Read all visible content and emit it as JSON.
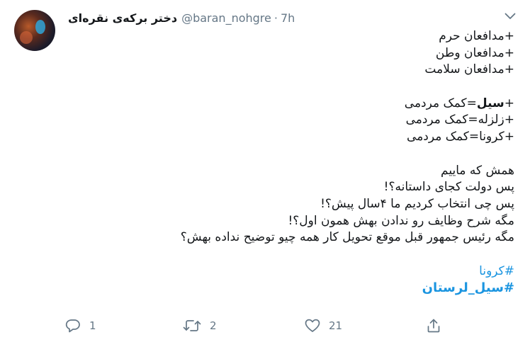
{
  "tweet": {
    "author": {
      "display_name": "دختر برکه‌ی نقره‌ای",
      "handle": "@baran_nohgre",
      "separator": "·",
      "time": "7h"
    },
    "lines": [
      "+مدافعان حرم",
      "+مدافعان وطن",
      "+مدافعان سلامت"
    ],
    "lines2": [
      {
        "prefix": "+",
        "bold": "سیل",
        "rest": "=کمک مردمی"
      },
      {
        "prefix": "",
        "bold": "",
        "rest": "+زلزله=کمک مردمی"
      },
      {
        "prefix": "",
        "bold": "",
        "rest": "+کرونا=کمک مردمی"
      }
    ],
    "lines3": [
      "همش که ماییم",
      "پس دولت کجای داستانه؟!",
      "پس چی انتخاب کردیم ما ۴سال پیش؟!",
      "مگه شرح وظایف رو ندادن بهش همون اول؟!",
      "مگه رئیس جمهور قبل موقع تحویل کار همه چیو توضیح نداده بهش؟"
    ],
    "hashtags": [
      "#کرونا",
      "#سیل_لرستان"
    ]
  },
  "actions": {
    "reply_count": "1",
    "retweet_count": "2",
    "like_count": "21"
  },
  "colors": {
    "text": "#14171a",
    "secondary": "#657786",
    "link": "#1b95e0"
  },
  "icons": {
    "menu": "chevron-down-icon",
    "reply": "reply-icon",
    "retweet": "retweet-icon",
    "like": "heart-icon",
    "share": "share-icon"
  }
}
